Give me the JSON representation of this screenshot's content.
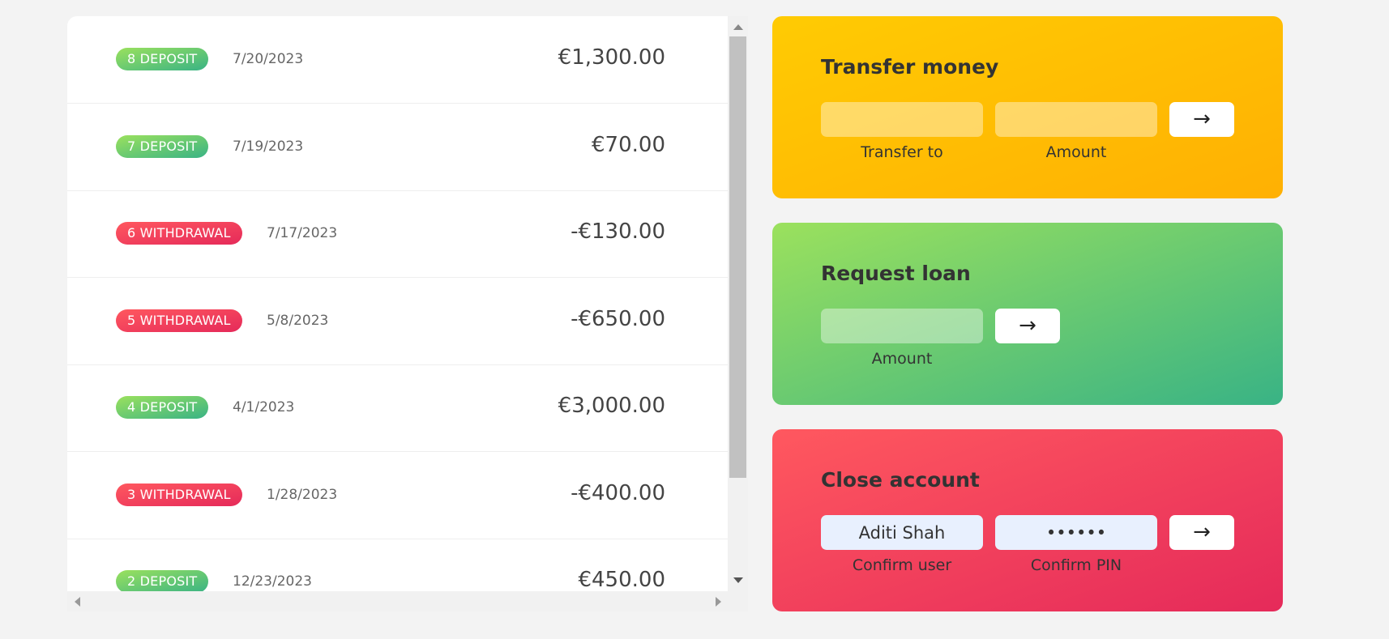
{
  "movements": [
    {
      "label": "8 DEPOSIT",
      "kind": "deposit",
      "date": "7/20/2023",
      "value": "€1,300.00"
    },
    {
      "label": "7 DEPOSIT",
      "kind": "deposit",
      "date": "7/19/2023",
      "value": "€70.00"
    },
    {
      "label": "6 WITHDRAWAL",
      "kind": "withdrawal",
      "date": "7/17/2023",
      "value": "-€130.00"
    },
    {
      "label": "5 WITHDRAWAL",
      "kind": "withdrawal",
      "date": "5/8/2023",
      "value": "-€650.00"
    },
    {
      "label": "4 DEPOSIT",
      "kind": "deposit",
      "date": "4/1/2023",
      "value": "€3,000.00"
    },
    {
      "label": "3 WITHDRAWAL",
      "kind": "withdrawal",
      "date": "1/28/2023",
      "value": "-€400.00"
    },
    {
      "label": "2 DEPOSIT",
      "kind": "deposit",
      "date": "12/23/2023",
      "value": "€450.00"
    }
  ],
  "transfer": {
    "title": "Transfer money",
    "to_value": "",
    "amount_value": "",
    "button": "→",
    "to_label": "Transfer to",
    "amount_label": "Amount"
  },
  "loan": {
    "title": "Request loan",
    "amount_value": "",
    "button": "→",
    "amount_label": "Amount"
  },
  "close": {
    "title": "Close account",
    "user_value": "Aditi Shah",
    "pin_value": "••••••",
    "button": "→",
    "user_label": "Confirm user",
    "pin_label": "Confirm PIN"
  },
  "colors": {
    "deposit": "#39b385",
    "withdrawal": "#e52a5a",
    "transfer": "#ffb003",
    "loan": "#9be15d",
    "close": "#ff585f"
  },
  "icons": {
    "arrow": "right-arrow-icon"
  }
}
